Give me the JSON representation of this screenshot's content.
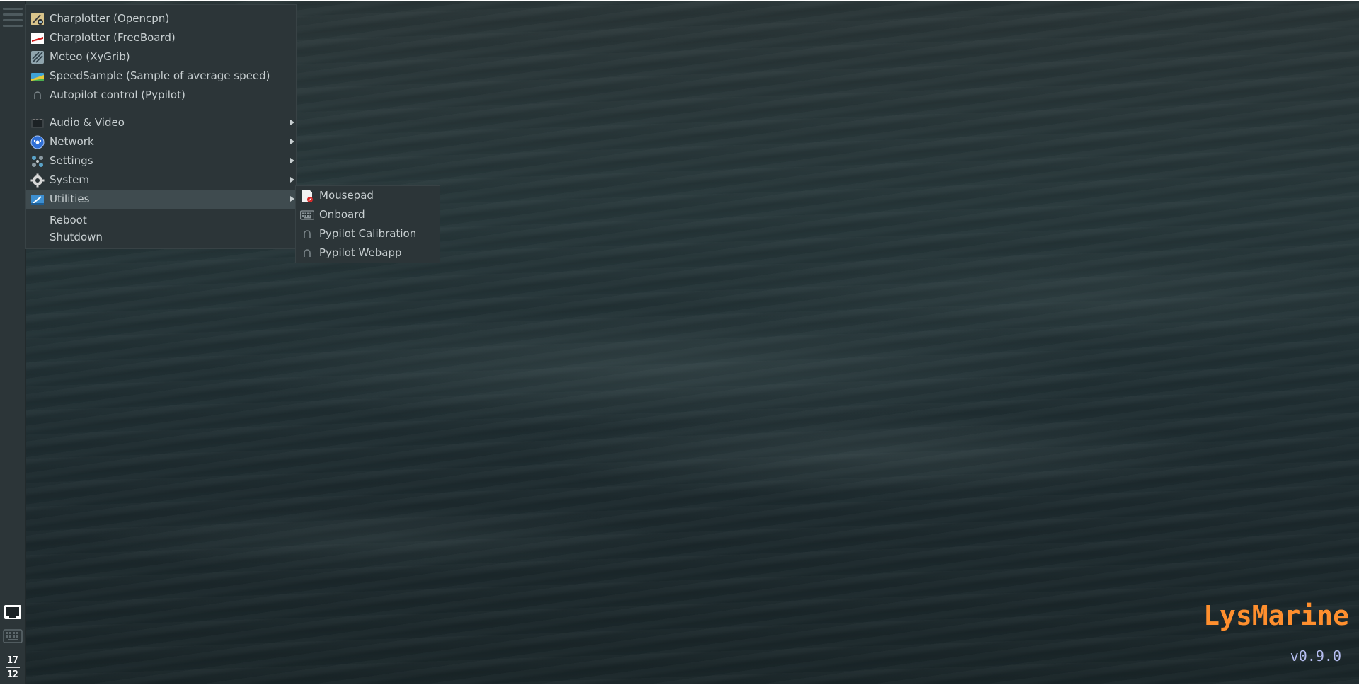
{
  "desktop": {
    "wallpaper": "dark-sea-waves",
    "brand_title": "LysMarine",
    "brand_version": "v0.9.0",
    "brand_color": "#ff8f2e",
    "version_color": "#b5bdf0"
  },
  "panel": {
    "menu_icon": "hamburger-menu-icon",
    "tray_icons": [
      "network-monitor-icon",
      "on-screen-keyboard-icon"
    ],
    "clock": {
      "hours": "17",
      "minutes": "12"
    }
  },
  "main_menu": {
    "apps": [
      {
        "label": "Charplotter (Opencpn)",
        "icon": "opencpn-icon"
      },
      {
        "label": "Charplotter (FreeBoard)",
        "icon": "freeboard-icon"
      },
      {
        "label": "Meteo (XyGrib)",
        "icon": "xygrib-icon"
      },
      {
        "label": "SpeedSample (Sample of average speed)",
        "icon": "speedsample-icon"
      },
      {
        "label": "Autopilot control (Pypilot)",
        "icon": "pypilot-icon"
      }
    ],
    "categories": [
      {
        "label": "Audio & Video",
        "icon": "multimedia-icon"
      },
      {
        "label": "Network",
        "icon": "network-globe-icon"
      },
      {
        "label": "Settings",
        "icon": "settings-icon"
      },
      {
        "label": "System",
        "icon": "system-gear-icon"
      },
      {
        "label": "Utilities",
        "icon": "utilities-icon",
        "active": true
      }
    ],
    "session": [
      {
        "label": "Reboot"
      },
      {
        "label": "Shutdown"
      }
    ],
    "highlight_color": "#3f4b4f",
    "background_color": "#2c3538"
  },
  "utilities_submenu": {
    "items": [
      {
        "label": "Mousepad",
        "icon": "mousepad-icon"
      },
      {
        "label": "Onboard",
        "icon": "keyboard-icon"
      },
      {
        "label": "Pypilot Calibration",
        "icon": "pypilot-icon"
      },
      {
        "label": "Pypilot Webapp",
        "icon": "pypilot-icon"
      }
    ]
  }
}
